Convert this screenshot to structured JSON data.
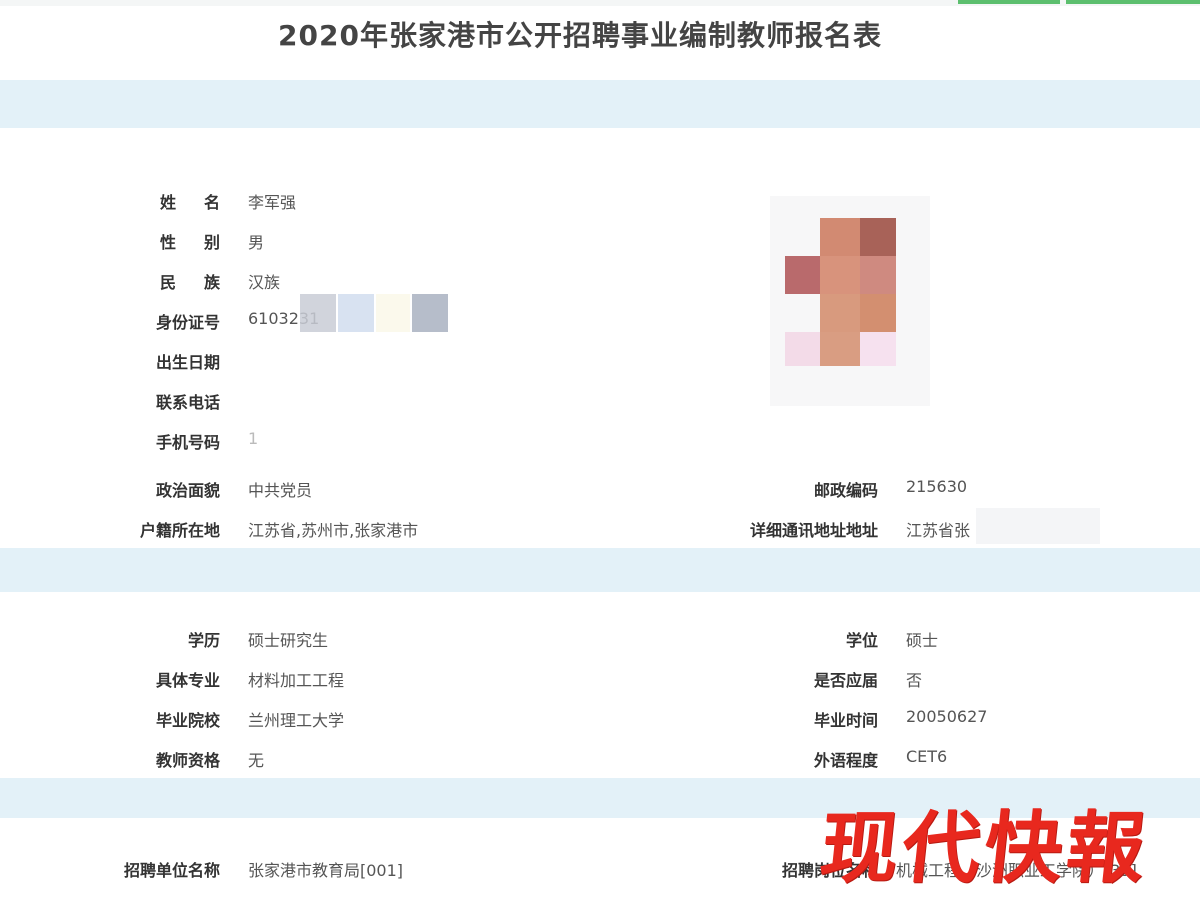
{
  "page": {
    "title": "2020年张家港市公开招聘事业编制教师报名表"
  },
  "personal": {
    "name_label": "姓名",
    "name_value": "李军强",
    "gender_label": "性别",
    "gender_value": "男",
    "ethnicity_label": "民族",
    "ethnicity_value": "汉族",
    "id_label": "身份证号",
    "id_value": "6103231",
    "birth_label": "出生日期",
    "phone_label": "联系电话",
    "mobile_label": "手机号码",
    "mobile_value": "1",
    "political_label": "政治面貌",
    "political_value": "中共党员",
    "postal_label": "邮政编码",
    "postal_value": "215630",
    "household_label": "户籍所在地",
    "household_value": "江苏省,苏州市,张家港市",
    "address_label": "详细通讯地址地址",
    "address_value": "江苏省张"
  },
  "education": {
    "education_label": "学历",
    "education_value": "硕士研究生",
    "degree_label": "学位",
    "degree_value": "硕士",
    "major_label": "具体专业",
    "major_value": "材料加工工程",
    "fresh_label": "是否应届",
    "fresh_value": "否",
    "school_label": "毕业院校",
    "school_value": "兰州理工大学",
    "grad_label": "毕业时间",
    "grad_value": "20050627",
    "cert_label": "教师资格",
    "cert_value": "无",
    "lang_label": "外语程度",
    "lang_value": "CET6"
  },
  "recruit": {
    "unit_label": "招聘单位名称",
    "unit_value": "张家港市教育局[001]",
    "position_label": "招聘岗位名称",
    "position_value": "机械工程（沙洲职业工学院）[39]"
  },
  "watermark": {
    "text": "现代快報",
    "color": "#e8281e"
  }
}
